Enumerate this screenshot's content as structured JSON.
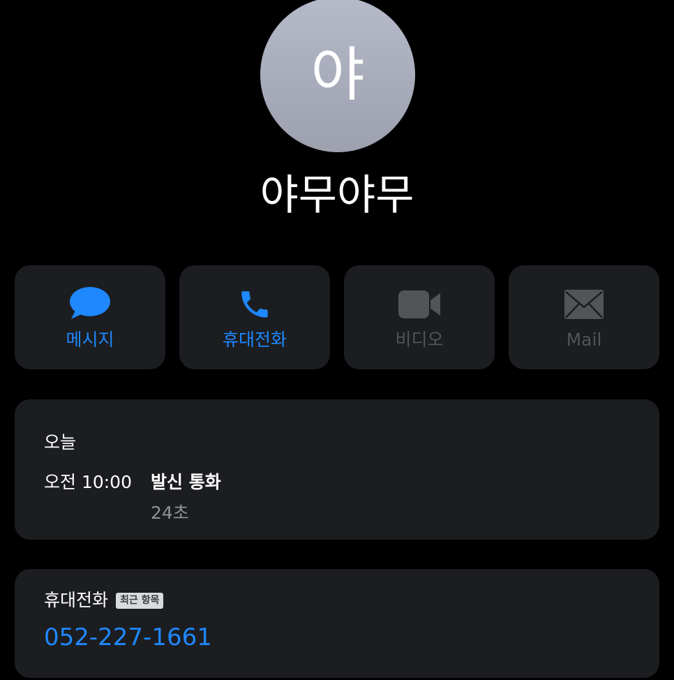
{
  "contact": {
    "initial": "야",
    "name": "야무야무"
  },
  "actions": [
    {
      "label": "메시지",
      "icon": "message-bubble-icon",
      "enabled": true
    },
    {
      "label": "휴대전화",
      "icon": "phone-icon",
      "enabled": true
    },
    {
      "label": "비디오",
      "icon": "video-camera-icon",
      "enabled": false
    },
    {
      "label": "Mail",
      "icon": "mail-envelope-icon",
      "enabled": false
    }
  ],
  "recents": {
    "day": "오늘",
    "entries": [
      {
        "time": "오전 10:00",
        "type": "발신 통화",
        "duration": "24초"
      }
    ]
  },
  "phone": {
    "label": "휴대전화",
    "badge": "최근 항목",
    "number": "052-227-1661"
  },
  "colors": {
    "background": "#000000",
    "card": "#1b1d20",
    "accent": "#1f88ff",
    "disabled": "#525558",
    "secondary_text": "#8e9196",
    "avatar_top": "#b6bac9",
    "avatar_bottom": "#9da0ad"
  }
}
